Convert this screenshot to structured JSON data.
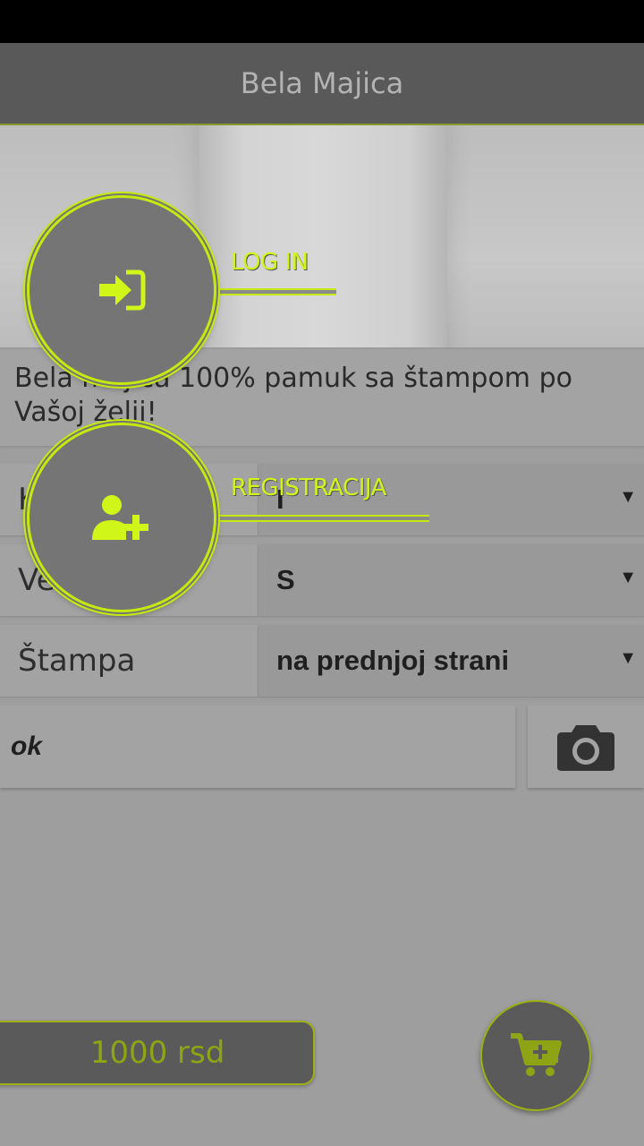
{
  "app_bar": {
    "title": "Bela Majica"
  },
  "product": {
    "description": "Bela majica 100% pamuk sa štampom po Vašoj želji!"
  },
  "options": [
    {
      "label": "K",
      "value": "I"
    },
    {
      "label": "Ve",
      "value": "S"
    },
    {
      "label": "Štampa",
      "value": "na prednjoj strani"
    }
  ],
  "note": {
    "value": "ok"
  },
  "price": {
    "label": "1000 rsd"
  },
  "menu": {
    "login_label": "LOG IN",
    "register_label": "REGISTRACIJA"
  },
  "colors": {
    "accent": "#c5ea0f",
    "accent_dim": "#9db014",
    "appbar": "#595959"
  },
  "icons": {
    "login": "sign-in-icon",
    "register": "user-plus-icon",
    "camera": "camera-icon",
    "cart": "cart-plus-icon"
  }
}
